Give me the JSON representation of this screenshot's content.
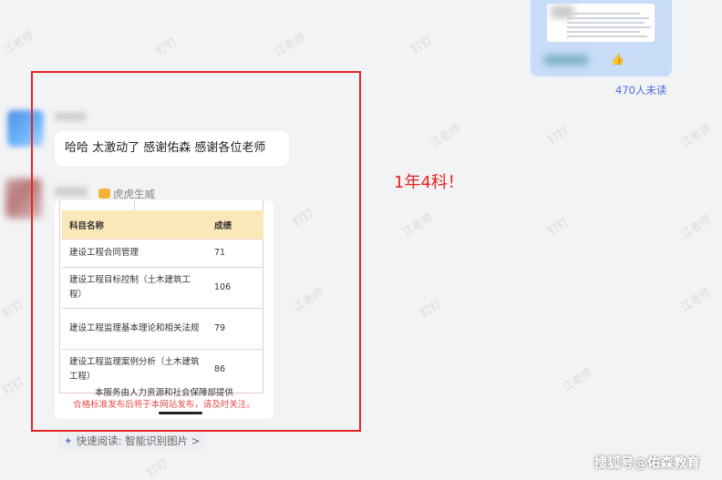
{
  "watermarks": [
    "江老师",
    "钉钉",
    "江老师",
    "钉钉",
    "江老师",
    "钉钉",
    "江老师",
    "钉钉",
    "江老师",
    "钉钉",
    "江老师",
    "钉钉",
    "江老师",
    "钉钉",
    "江老师",
    "钉钉",
    "江老师",
    "钉钉"
  ],
  "sent": {
    "unread_label": "470人未读"
  },
  "message1": {
    "text": "哈哈 太激动了 感谢佑森 感谢各位老师"
  },
  "message2": {
    "nickname": "虎虎生威",
    "table": {
      "headers": [
        "科目名称",
        "成绩"
      ],
      "rows": [
        [
          "建设工程合同管理",
          "71"
        ],
        [
          "建设工程目标控制（土木建筑工程）",
          "106"
        ],
        [
          "建设工程监理基本理论和相关法规",
          "79"
        ],
        [
          "建设工程监理案例分析（土木建筑工程）",
          "86"
        ]
      ]
    },
    "note_provider": "本服务由人力资源和社会保障部提供",
    "note_publish": "合格标准发布后将于本网站发布，请及时关注。"
  },
  "annotation": "1年4科！",
  "quick_read": {
    "label": "快速阅读: 智能识别图片 >"
  },
  "brand_watermark": "搜狐号@佑森教育",
  "colors": {
    "accent_red": "#e52424",
    "link_blue": "#4a6fd3",
    "table_header": "#fbe8b9"
  }
}
